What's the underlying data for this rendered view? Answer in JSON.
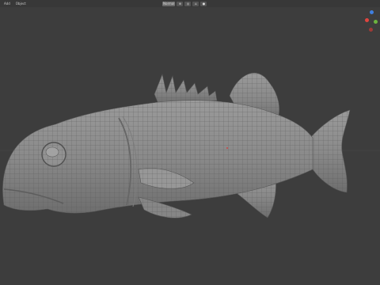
{
  "header": {
    "menu": [
      "Add",
      "Object"
    ],
    "viewport_mode": "Normal",
    "tool_icons": [
      "global-icon",
      "pivot-icon",
      "snap-icon",
      "proportional-icon"
    ]
  },
  "viewport": {
    "background_color": "#3d3d3d",
    "mesh_color": "#8d8d8d",
    "wire_color": "#5a5a5a",
    "gizmo_colors": {
      "x": "#e0453f",
      "y": "#6cb33f",
      "z": "#3f7fe0"
    }
  }
}
